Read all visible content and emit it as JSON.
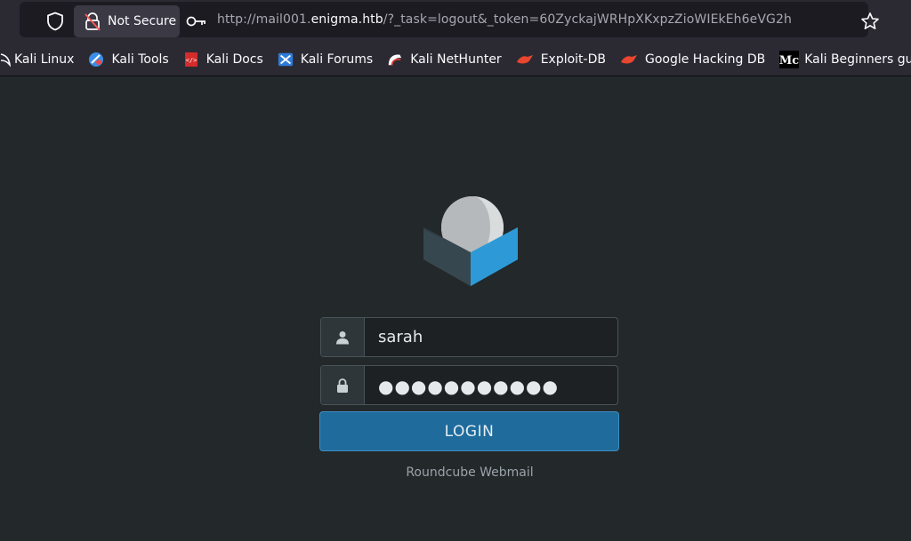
{
  "browser": {
    "security_label": "Not Secure",
    "url_prefix": "http://mail001.",
    "url_domain": "enigma.htb",
    "url_suffix": "/?_task=logout&_token=60ZyckajWRHpXKxpzZioWIEkEh6eVG2h",
    "bookmarks": [
      {
        "label": "Kali Linux",
        "icon": "kali-dragon-icon"
      },
      {
        "label": "Kali Tools",
        "icon": "kali-tools-icon"
      },
      {
        "label": "Kali Docs",
        "icon": "kali-docs-icon"
      },
      {
        "label": "Kali Forums",
        "icon": "kali-forums-icon"
      },
      {
        "label": "Kali NetHunter",
        "icon": "nethunter-icon"
      },
      {
        "label": "Exploit-DB",
        "icon": "exploit-db-icon"
      },
      {
        "label": "Google Hacking DB",
        "icon": "ghdb-icon"
      },
      {
        "label": "Kali Beginners guide:…",
        "icon": "medium-icon"
      }
    ]
  },
  "login": {
    "username_value": "sarah",
    "password_mask": "●●●●●●●●●●●",
    "button_label": "LOGIN",
    "product_name": "Roundcube Webmail"
  },
  "colors": {
    "page_bg": "#23282b",
    "button_bg": "#1e6b9c",
    "logo_blue": "#2d9ad7",
    "logo_dark": "#37474f"
  }
}
